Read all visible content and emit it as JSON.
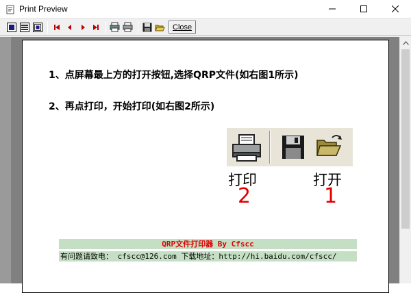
{
  "window": {
    "title": "Print Preview",
    "icons": [
      "app-icon",
      "minimize-icon",
      "maximize-icon",
      "close-icon"
    ]
  },
  "toolbar": {
    "buttons": [
      "fit-page-icon",
      "fit-width-icon",
      "zoom-icon",
      "first-page-icon",
      "prev-page-icon",
      "next-page-icon",
      "last-page-icon",
      "printer-setup-icon",
      "print-icon",
      "save-icon",
      "open-icon"
    ],
    "close_label": "Close"
  },
  "page": {
    "line1": "1、点屏幕最上方的打开按钮,选择QRP文件(如右图1所示)",
    "line2": "2、再点打印，开始打印(如右图2所示)",
    "caption_print": "打印",
    "caption_open": "打开",
    "num_print": "2",
    "num_open": "1",
    "banner_title": "QRP文件打印器 By Cfscc",
    "banner_contact": "有问题请致电： cfscc@126.com    下载地址：http://hi.baidu.com/cfscc/"
  },
  "colors": {
    "accent_red": "#e00000",
    "banner_green": "#c4dfc4",
    "preview_gray": "#808080"
  }
}
